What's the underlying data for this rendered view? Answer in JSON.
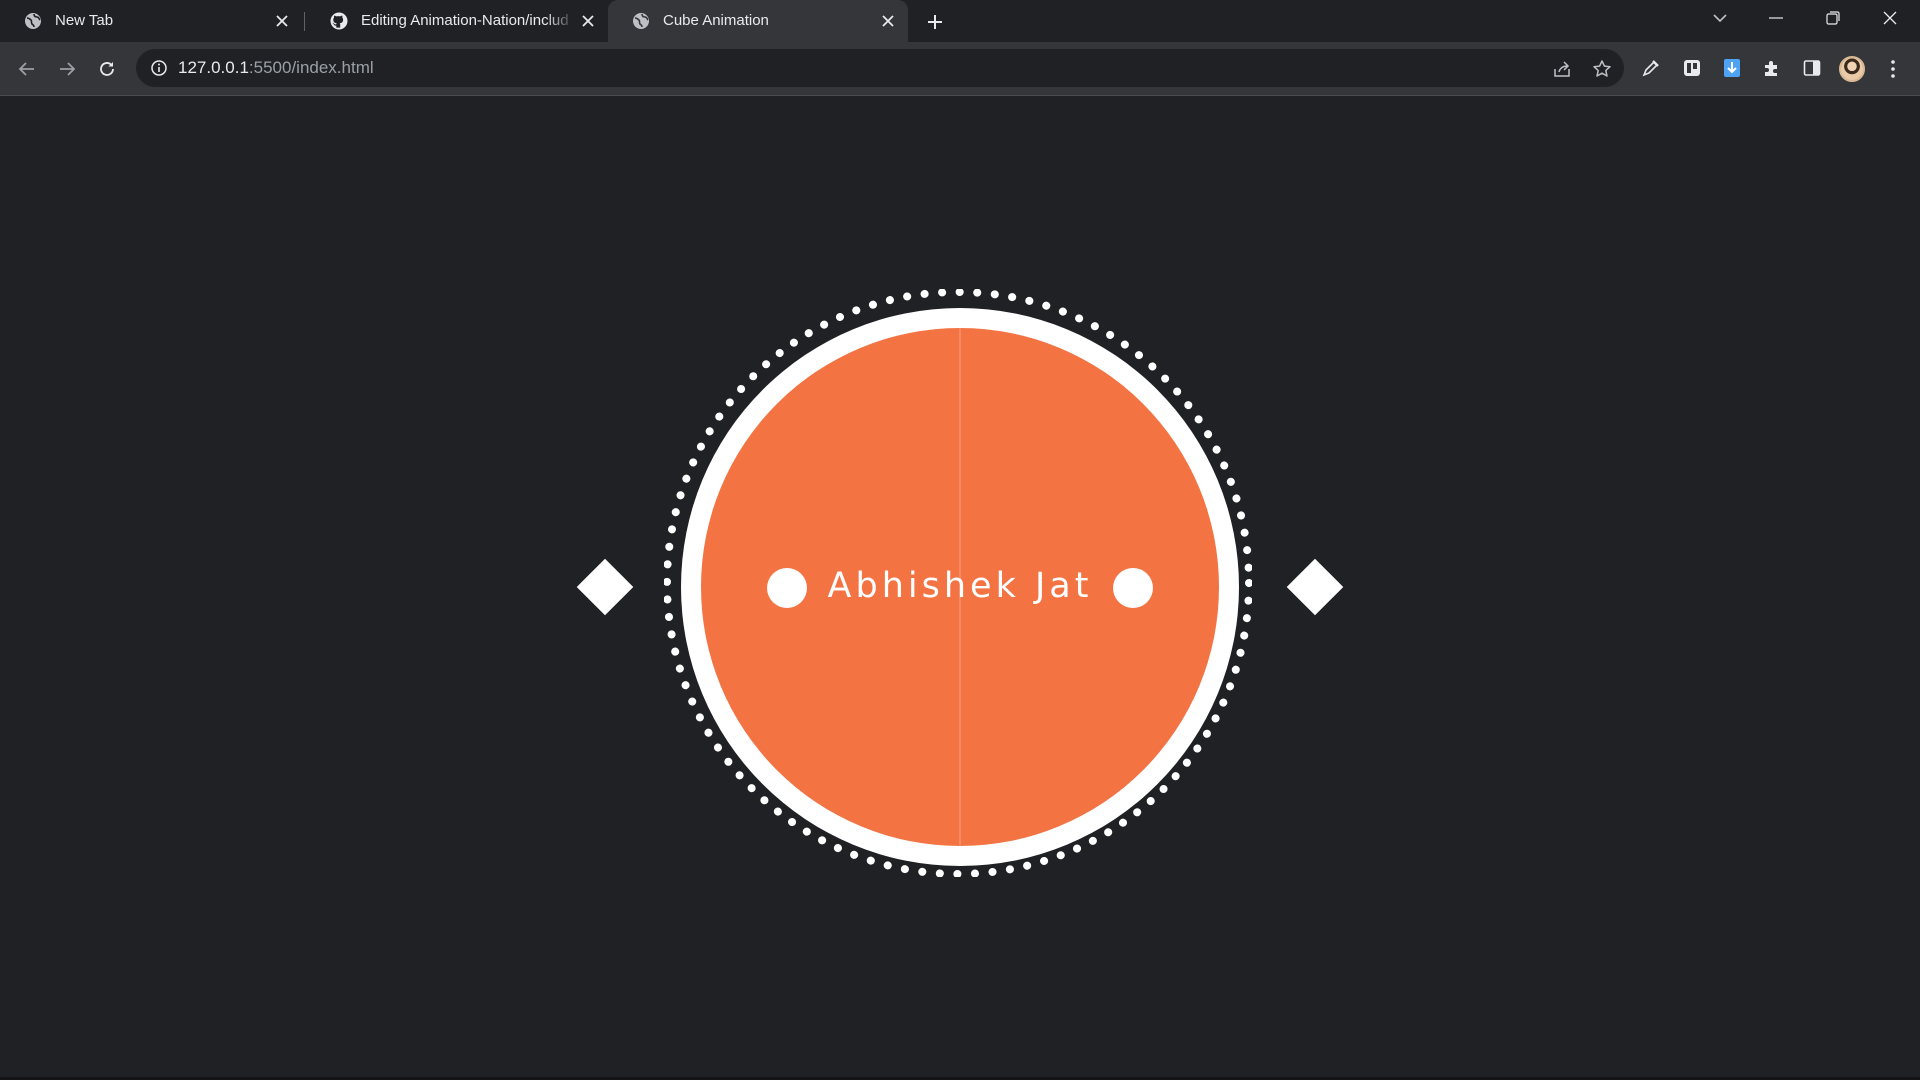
{
  "browser": {
    "tabs": [
      {
        "title": "New Tab",
        "icon": "globe-icon",
        "active": false
      },
      {
        "title": "Editing Animation-Nation/includ",
        "icon": "github-icon",
        "active": false
      },
      {
        "title": "Cube Animation",
        "icon": "globe-icon",
        "active": true
      }
    ],
    "address_bar": {
      "host": "127.0.0.1",
      "rest": ":5500/index.html"
    },
    "extensions": [
      "color-picker-icon",
      "trello-icon",
      "download-icon",
      "extensions-puzzle-icon"
    ]
  },
  "page": {
    "name": "Abhishek Jat"
  },
  "colors": {
    "page_background": "#202124",
    "disc": "#f37343",
    "ring": "#ffffff",
    "tab_active": "#35363a",
    "toolbar": "#35363a"
  }
}
